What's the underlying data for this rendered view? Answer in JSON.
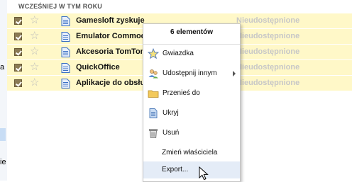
{
  "left_fragments": [
    "a",
    "ie"
  ],
  "section_header": "WCZEŚNIEJ W TYM ROKU",
  "rows": [
    {
      "title": "Gamesloft zyskuje dzięki iPhone",
      "share": "Nieudostępnione"
    },
    {
      "title": "Emulator Commodore",
      "share": "Nieudostępnione"
    },
    {
      "title": "Akcesoria TomTom",
      "share": "Nieudostępnione"
    },
    {
      "title": "QuickOffice",
      "share": "Nieudostępnione"
    },
    {
      "title": "Aplikacje do obsługi",
      "share": "Nieudostępnione"
    }
  ],
  "context_menu": {
    "header": "6 elementów",
    "items": [
      {
        "label": "Gwiazdka",
        "icon": "star-icon"
      },
      {
        "label": "Udostępnij innym",
        "icon": "share-people-icon",
        "submenu": true
      },
      {
        "label": "Przenieś do",
        "icon": "folder-icon"
      },
      {
        "label": "Ukryj",
        "icon": "hide-document-icon"
      },
      {
        "label": "Usuń",
        "icon": "trash-icon"
      },
      {
        "label": "Zmień właściciela"
      },
      {
        "label": "Export...",
        "hovered": true
      }
    ]
  },
  "colors": {
    "row_background": "#fff8c8",
    "unshared_text": "#c7c7c7",
    "hover_background": "#e4ecf7",
    "checkbox": "#8a7a54"
  }
}
